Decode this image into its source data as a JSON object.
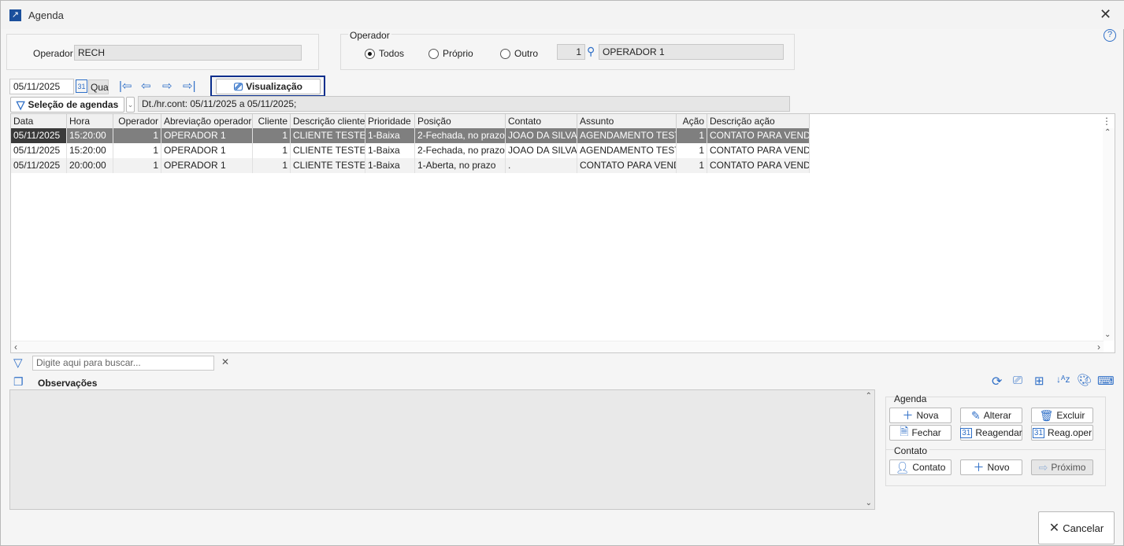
{
  "window": {
    "title": "Agenda"
  },
  "operator_box": {
    "label": "Operador",
    "value": "RECH"
  },
  "operator_filter": {
    "legend": "Operador",
    "options": [
      "Todos",
      "Próprio",
      "Outro"
    ],
    "selected": "Todos",
    "code": "1",
    "name": "OPERADOR 1"
  },
  "toolbar": {
    "date": "05/11/2025",
    "weekday": "Qua",
    "view_label": "Visualização",
    "selection_label": "Seleção de agendas",
    "filter_text": "Dt./hr.cont: 05/11/2025 a 05/11/2025;"
  },
  "table": {
    "columns": [
      "Data",
      "Hora",
      "Operador",
      "Abreviação operador",
      "Cliente",
      "Descrição cliente",
      "Prioridade",
      "Posição",
      "Contato",
      "Assunto",
      "Ação",
      "Descrição ação"
    ],
    "rows": [
      [
        "05/11/2025",
        "15:20:00",
        "1",
        "OPERADOR 1",
        "1",
        "CLIENTE TESTE",
        "1-Baixa",
        "2-Fechada, no prazo",
        "JOAO DA SILVA",
        "AGENDAMENTO TESTE",
        "1",
        "CONTATO PARA VENDA"
      ],
      [
        "05/11/2025",
        "15:20:00",
        "1",
        "OPERADOR 1",
        "1",
        "CLIENTE TESTE",
        "1-Baixa",
        "2-Fechada, no prazo",
        "JOAO DA SILVA",
        "AGENDAMENTO TESTE",
        "1",
        "CONTATO PARA VENDA"
      ],
      [
        "05/11/2025",
        "20:00:00",
        "1",
        "OPERADOR 1",
        "1",
        "CLIENTE TESTE",
        "1-Baixa",
        "1-Aberta, no prazo",
        ".",
        "CONTATO PARA VENDA",
        "1",
        "CONTATO PARA VENDA"
      ]
    ]
  },
  "search": {
    "placeholder": "Digite aqui para buscar..."
  },
  "observations": {
    "label": "Observações"
  },
  "agenda_group": {
    "legend": "Agenda",
    "buttons": [
      "Nova",
      "Alterar",
      "Excluir",
      "Fechar",
      "Reagendar",
      "Reag.oper"
    ]
  },
  "contato_group": {
    "legend": "Contato",
    "buttons": [
      "Contato",
      "Novo",
      "Próximo"
    ]
  },
  "cancel_label": "Cancelar"
}
